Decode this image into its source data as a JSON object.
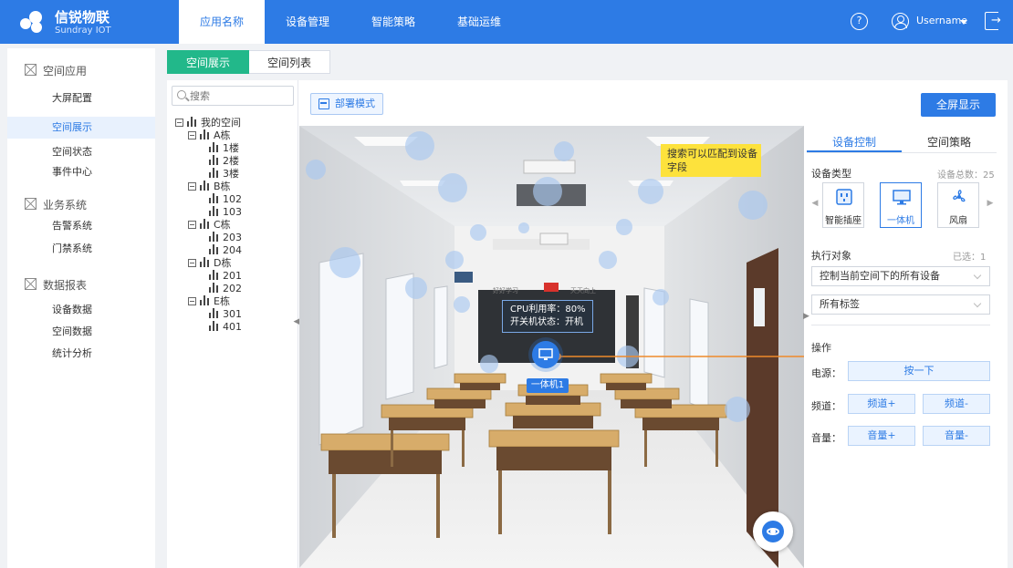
{
  "app": {
    "title": "信锐物联",
    "subtitle": "Sundray IOT",
    "nav": [
      "应用名称",
      "设备管理",
      "智能策略",
      "基础运维"
    ],
    "help_label": "?",
    "username": "Username"
  },
  "sidebar": {
    "groups": [
      {
        "label": "空间应用",
        "items": [
          "大屏配置",
          "空间展示",
          "空间状态",
          "事件中心"
        ]
      },
      {
        "label": "业务系统",
        "items": [
          "告警系统",
          "门禁系统"
        ]
      },
      {
        "label": "数据报表",
        "items": [
          "设备数据",
          "空间数据",
          "统计分析"
        ]
      }
    ]
  },
  "tabs": [
    "空间展示",
    "空间列表"
  ],
  "search": {
    "placeholder": "搜索"
  },
  "tree": {
    "root": "我的空间",
    "buildings": [
      {
        "name": "A栋",
        "floors": [
          "1楼",
          "2楼",
          "3楼"
        ]
      },
      {
        "name": "B栋",
        "floors": [
          "102",
          "103"
        ]
      },
      {
        "name": "C栋",
        "floors": [
          "203",
          "204"
        ]
      },
      {
        "name": "D栋",
        "floors": [
          "201",
          "202"
        ]
      },
      {
        "name": "E栋",
        "floors": [
          "301",
          "401"
        ]
      }
    ]
  },
  "toolbar": {
    "deploy_label": "部署模式",
    "fullscreen_label": "全屏显示"
  },
  "scene": {
    "hint": "搜索可以匹配到设备字段",
    "hint_line1": "搜索可以匹配到设备",
    "hint_line2": "字段",
    "status_line1": "CPU利用率：80%",
    "status_line2": "开关机状态：开机",
    "device_name": "一体机1",
    "banner_left": "好好学习",
    "banner_right": "天天向上"
  },
  "panel": {
    "tabs": [
      "设备控制",
      "空间策略"
    ],
    "device_type_label": "设备类型",
    "device_total": "设备总数：25",
    "device_types": [
      "智能插座",
      "一体机",
      "风扇"
    ],
    "target_label": "执行对象",
    "selected_count": "已选：1",
    "target_select": "控制当前空间下的所有设备",
    "tag_select": "所有标签",
    "operation_label": "操作",
    "power_label": "电源：",
    "power_button": "按一下",
    "channel_label": "频道：",
    "channel_up": "频道+",
    "channel_down": "频道-",
    "volume_label": "音量：",
    "volume_up": "音量+",
    "volume_down": "音量-"
  },
  "colors": {
    "primary": "#2d7be5",
    "tab_active": "#22b88a",
    "hint_bg": "#fde23c",
    "link_line": "#ef8a2a"
  }
}
